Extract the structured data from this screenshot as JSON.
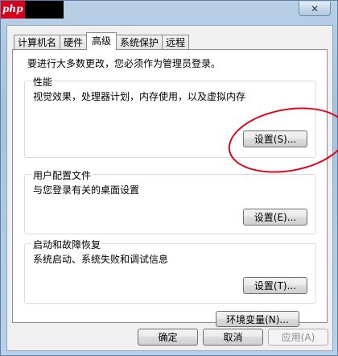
{
  "title_bar": {
    "logo_text": "php",
    "close_glyph": "✕"
  },
  "tabs": [
    {
      "label": "计算机名",
      "active": false
    },
    {
      "label": "硬件",
      "active": false
    },
    {
      "label": "高级",
      "active": true
    },
    {
      "label": "系统保护",
      "active": false
    },
    {
      "label": "远程",
      "active": false
    }
  ],
  "admin_note": "要进行大多数更改，您必须作为管理员登录。",
  "performance": {
    "title": "性能",
    "description": "视觉效果，处理器计划，内存使用，以及虚拟内存",
    "button": "设置(S)..."
  },
  "user_profiles": {
    "title": "用户配置文件",
    "description": "与您登录有关的桌面设置",
    "button": "设置(E)..."
  },
  "startup_recovery": {
    "title": "启动和故障恢复",
    "description": "系统启动、系统失败和调试信息",
    "button": "设置(T)..."
  },
  "env_button": "环境变量(N)...",
  "footer": {
    "ok": "确定",
    "cancel": "取消",
    "apply": "应用(A)"
  },
  "colors": {
    "annotation": "#e3001b",
    "logo_bg": "#d6001c"
  }
}
